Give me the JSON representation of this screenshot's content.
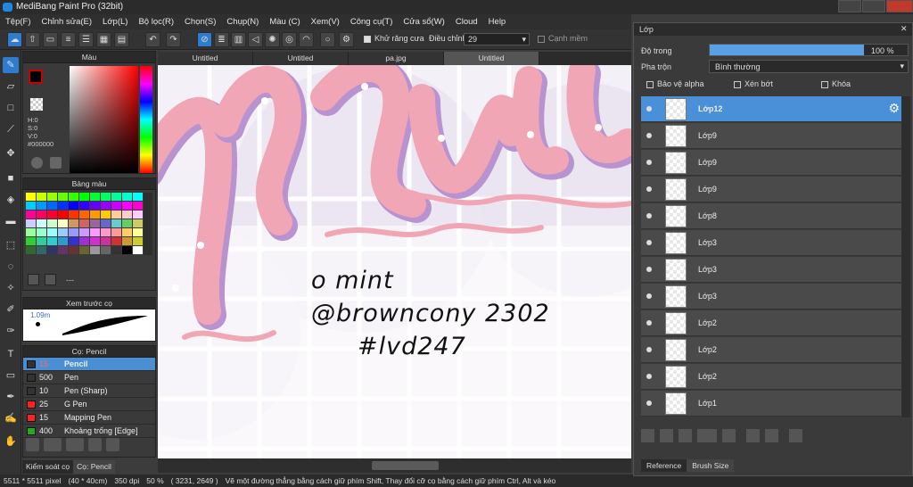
{
  "window": {
    "title": "MediBang Paint Pro (32bit)"
  },
  "menu": [
    "Tệp(F)",
    "Chỉnh sửa(E)",
    "Lớp(L)",
    "Bộ lọc(R)",
    "Chọn(S)",
    "Chụp(N)",
    "Màu (C)",
    "Xem(V)",
    "Công cụ(T)",
    "Cửa sổ(W)",
    "Cloud",
    "Help"
  ],
  "toolbar": {
    "antialias_label": "Khử răng cưa",
    "adjust_label": "Điều chỉnh",
    "adjust_value": "29",
    "edge_label": "Cạnh mềm"
  },
  "color_panel": {
    "title": "Màu",
    "h": "H:0",
    "s": "S:0",
    "v": "V:0",
    "hex": "#000000",
    "fg_color": "#000000",
    "bg_color": "#ffffff"
  },
  "swatch_panel": {
    "title": "Bảng màu",
    "extra": "---",
    "colors": [
      "#ffff00",
      "#ccff00",
      "#99ff00",
      "#66ff00",
      "#33ff00",
      "#00ff00",
      "#00ff33",
      "#00ff66",
      "#00ff99",
      "#00ffcc",
      "#00ffff",
      "#00ccff",
      "#0099ff",
      "#0066ff",
      "#0033ff",
      "#0000ff",
      "#3300ff",
      "#6600ff",
      "#9900ff",
      "#cc00ff",
      "#ff00ff",
      "#ff00cc",
      "#ff0099",
      "#ff0066",
      "#ff0033",
      "#ff0000",
      "#ff3300",
      "#ff6600",
      "#ff9900",
      "#ffcc00",
      "#ffcc99",
      "#ffcccc",
      "#ffccff",
      "#ccccff",
      "#ccffff",
      "#ccffcc",
      "#ffffcc",
      "#cc9966",
      "#cc6666",
      "#996699",
      "#6666cc",
      "#66cccc",
      "#66cc66",
      "#cccc66",
      "#99ff99",
      "#99ffcc",
      "#99ffff",
      "#99ccff",
      "#9999ff",
      "#cc99ff",
      "#ff99ff",
      "#ff99cc",
      "#ff9999",
      "#ffcc66",
      "#ffff99",
      "#33cc33",
      "#33cc99",
      "#33cccc",
      "#3399cc",
      "#3333cc",
      "#9933cc",
      "#cc33cc",
      "#cc3399",
      "#cc3333",
      "#cc9933",
      "#cccc33",
      "#336633",
      "#336666",
      "#333366",
      "#663366",
      "#663333",
      "#666633",
      "#999999",
      "#666666",
      "#333333",
      "#000000",
      "#ffffff"
    ]
  },
  "preview_panel": {
    "title": "Xem trước cọ",
    "size": "1.09m"
  },
  "brush_panel": {
    "title": "Cọ: Pencil",
    "items": [
      {
        "size": "15",
        "name": "Pencil",
        "color": "#333333"
      },
      {
        "size": "500",
        "name": "Pen",
        "color": "#333333"
      },
      {
        "size": "10",
        "name": "Pen (Sharp)",
        "color": "#333333"
      },
      {
        "size": "25",
        "name": "G Pen",
        "color": "#ff2222"
      },
      {
        "size": "15",
        "name": "Mapping Pen",
        "color": "#ff2222"
      },
      {
        "size": "400",
        "name": "Khoảng trống [Edge]",
        "color": "#22aa22"
      }
    ]
  },
  "bottom_tabs": {
    "left": "Kiểm soát cọ",
    "right": "Cọ: Pencil"
  },
  "doc_tabs": [
    "Untitled",
    "Untitled",
    "pa.jpg",
    "Untitled"
  ],
  "canvas_text": {
    "line1": "o mint",
    "line2": "@browncony 2302",
    "line3": "#lvd247"
  },
  "status": {
    "size": "5511 * 5511 pixel",
    "cm": "(40 * 40cm)",
    "dpi": "350 dpi",
    "zoom": "50 %",
    "coords": "( 3231, 2649 )",
    "hint": "Vẽ một đường thẳng bằng cách giữ phím Shift, Thay đổi cỡ cọ bằng cách giữ phím Ctrl, Alt và kéo"
  },
  "layer_panel": {
    "title": "Lớp",
    "opacity_label": "Độ trong",
    "opacity_value": "100 %",
    "opacity": 1.0,
    "blend_label": "Pha trộn",
    "blend_value": "Bình thường",
    "protect_alpha": "Bảo vệ alpha",
    "clipping": "Xén bớt",
    "lock": "Khóa",
    "layers": [
      "Lớp12",
      "Lớp9",
      "Lớp9",
      "Lớp9",
      "Lớp8",
      "Lớp3",
      "Lớp3",
      "Lớp3",
      "Lớp2",
      "Lớp2",
      "Lớp2",
      "Lớp1"
    ],
    "tab_reference": "Reference",
    "tab_brushsize": "Brush Size"
  }
}
